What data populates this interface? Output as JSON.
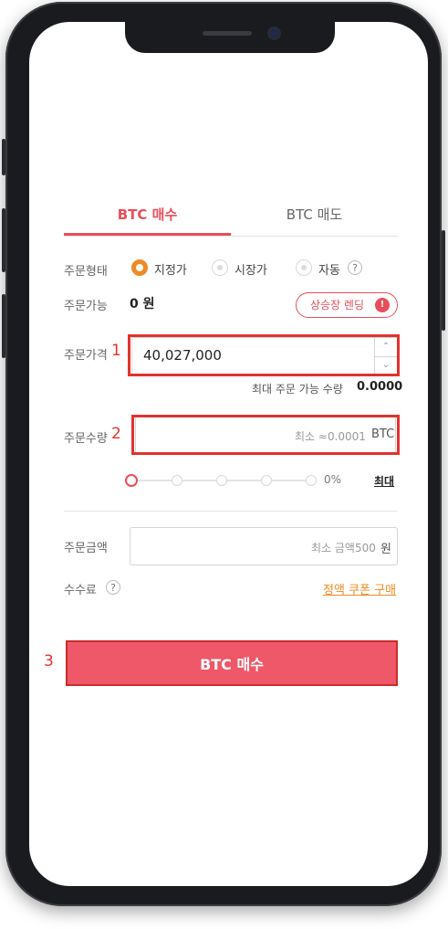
{
  "tabs": {
    "buy": "BTC 매수",
    "sell": "BTC 매도"
  },
  "order_type": {
    "label": "주문형태",
    "options": [
      "지정가",
      "시장가",
      "자동"
    ],
    "selected": "지정가",
    "help": "?"
  },
  "available": {
    "label": "주문가능",
    "value": "0 원"
  },
  "listing_badge": {
    "label": "상승장 렌딩",
    "icon": "!"
  },
  "price": {
    "label": "주문가격",
    "value": "40,027,000",
    "stepper_up": "⌃",
    "stepper_down": "⌄"
  },
  "max_qty": {
    "label": "최대 주문 가능 수량",
    "value": "0.0000"
  },
  "quantity": {
    "label": "주문수량",
    "placeholder": "최소 ≈0.0001",
    "unit": "BTC"
  },
  "slider": {
    "percent": "0%",
    "max_label": "최대",
    "value_fraction": 0
  },
  "amount": {
    "label": "주문금액",
    "placeholder": "최소 금액500",
    "unit": "원"
  },
  "fee": {
    "label": "수수료",
    "help": "?",
    "coupon_link": "정액 쿠폰 구매"
  },
  "submit": {
    "label": "BTC 매수"
  },
  "annotations": {
    "n1": "1",
    "n2": "2",
    "n3": "3"
  },
  "colors": {
    "accent": "#e84e5b",
    "orange": "#f08a24",
    "highlight": "#e0332f",
    "button": "#ee5868"
  }
}
